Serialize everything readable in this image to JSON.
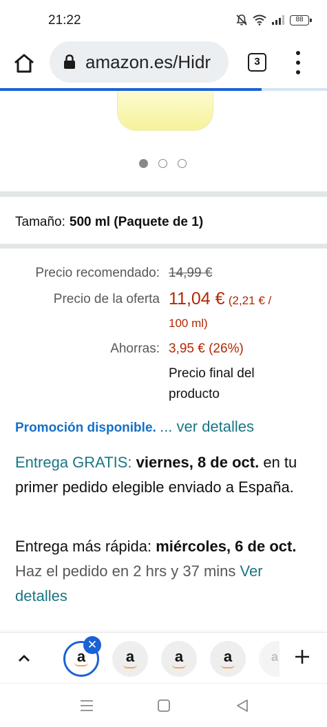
{
  "status_bar": {
    "time": "21:22",
    "battery": "88"
  },
  "browser": {
    "url": "amazon.es/Hidr",
    "tab_count": "3",
    "load_progress": 0.8
  },
  "carousel": {
    "dot_count": 3,
    "active_index": 0
  },
  "size": {
    "label": "Tamaño:",
    "value": "500 ml (Paquete de 1)"
  },
  "price": {
    "recommended_label": "Precio recomendado:",
    "recommended_value": "14,99 €",
    "offer_label": "Precio de la oferta",
    "offer_value": "11,04 €",
    "unit_price_line1": "(2,21 € /",
    "unit_price_line2": "100 ml)",
    "savings_label": "Ahorras:",
    "savings_value": "3,95 € (26%)",
    "final_note": "Precio final del producto"
  },
  "promotion": {
    "text": "Promoción disponible.",
    "link": "... ver detalles"
  },
  "delivery": {
    "free_label": "Entrega GRATIS:",
    "free_date": "viernes, 8 de oct.",
    "free_condition": "en tu primer pedido elegible enviado a España.",
    "fast_label": "Entrega más rápida:",
    "fast_date": "miércoles, 6 de oct.",
    "order_within": "Haz el pedido en 2 hrs y 37 mins",
    "details_link": "Ver detalles"
  },
  "tab_strip": {
    "tab_letter": "a",
    "close_symbol": "✕"
  },
  "colors": {
    "accent_blue": "#1a62d6",
    "price_red": "#b12704",
    "link_teal": "#1a7682",
    "promo_blue": "#1570c7"
  }
}
